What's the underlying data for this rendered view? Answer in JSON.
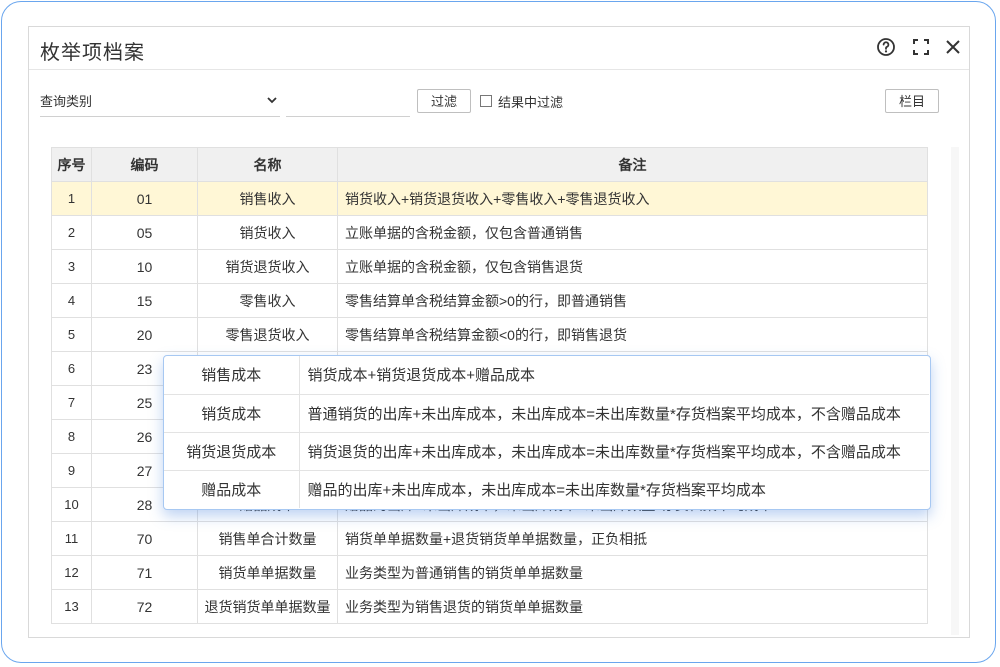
{
  "window": {
    "title": "枚举项档案"
  },
  "toolbar": {
    "query_category": "查询类别",
    "search_value": "",
    "filter_label": "过滤",
    "filter_in_results_label": "结果中过滤",
    "filter_in_results_checked": false,
    "columns_label": "栏目"
  },
  "table": {
    "headers": [
      "序号",
      "编码",
      "名称",
      "备注"
    ],
    "rows": [
      {
        "idx": "1",
        "code": "01",
        "name": "销售收入",
        "remark": "销货收入+销货退货收入+零售收入+零售退货收入"
      },
      {
        "idx": "2",
        "code": "05",
        "name": "销货收入",
        "remark": "立账单据的含税金额，仅包含普通销售"
      },
      {
        "idx": "3",
        "code": "10",
        "name": "销货退货收入",
        "remark": "立账单据的含税金额，仅包含销售退货"
      },
      {
        "idx": "4",
        "code": "15",
        "name": "零售收入",
        "remark": "零售结算单含税结算金额>0的行，即普通销售"
      },
      {
        "idx": "5",
        "code": "20",
        "name": "零售退货收入",
        "remark": "零售结算单含税结算金额<0的行，即销售退货"
      },
      {
        "idx": "6",
        "code": "23",
        "name": "",
        "remark": ""
      },
      {
        "idx": "7",
        "code": "25",
        "name": "",
        "remark": ""
      },
      {
        "idx": "8",
        "code": "26",
        "name": "",
        "remark": ""
      },
      {
        "idx": "9",
        "code": "27",
        "name": "",
        "remark": ""
      },
      {
        "idx": "10",
        "code": "28",
        "name": "赠品成本",
        "remark": "赠品的出库+未出库成本，未出库成本=未出库数量*存货档案平均成本"
      },
      {
        "idx": "11",
        "code": "70",
        "name": "销售单合计数量",
        "remark": "销货单单据数量+退货销货单单据数量，正负相抵"
      },
      {
        "idx": "12",
        "code": "71",
        "name": "销货单单据数量",
        "remark": "业务类型为普通销售的销货单单据数量"
      },
      {
        "idx": "13",
        "code": "72",
        "name": "退货销货单单据数量",
        "remark": "业务类型为销售退货的销货单单据数量"
      }
    ]
  },
  "popup": {
    "rows": [
      {
        "name": "销售成本",
        "remark": "销货成本+销货退货成本+赠品成本"
      },
      {
        "name": "销货成本",
        "remark": "普通销货的出库+未出库成本，未出库成本=未出库数量*存货档案平均成本，不含赠品成本"
      },
      {
        "name": "销货退货成本",
        "remark": "销货退货的出库+未出库成本，未出库成本=未出库数量*存货档案平均成本，不含赠品成本"
      },
      {
        "name": "赠品成本",
        "remark": "赠品的出库+未出库成本，未出库成本=未出库数量*存货档案平均成本"
      }
    ]
  },
  "icons": {
    "help": "help-circle-icon",
    "expand": "expand-icon",
    "close": "close-icon",
    "dropdown": "chevron-down-icon"
  },
  "colors": {
    "accent": "#6aa6ee",
    "selected_row": "#fff7d6",
    "header_bg": "#f0f0f0"
  }
}
